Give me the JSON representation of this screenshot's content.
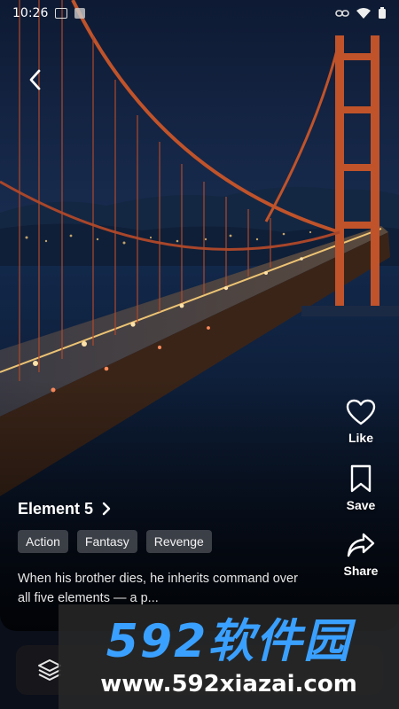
{
  "status_bar": {
    "time": "10:26"
  },
  "detail": {
    "title": "Element 5",
    "tags": [
      "Action",
      "Fantasy",
      "Revenge"
    ],
    "description": "When his brother dies, he inherits command over all five elements — a p..."
  },
  "actions": {
    "like_label": "Like",
    "save_label": "Save",
    "share_label": "Share"
  },
  "watermark": {
    "logo_text": "592软件园",
    "url": "www.592xiazai.com"
  },
  "colors": {
    "sky_top": "#0f1e3a",
    "water": "#0c1830",
    "bridge": "#c0532a",
    "watermark_blue": "#3aa0ff",
    "bottom_bar": "#17171b"
  },
  "icons": {
    "back": "chevron-left-icon",
    "like": "heart-icon",
    "save": "bookmark-icon",
    "share": "share-arrow-icon",
    "layers": "layers-icon",
    "title_more": "chevron-right-icon"
  }
}
